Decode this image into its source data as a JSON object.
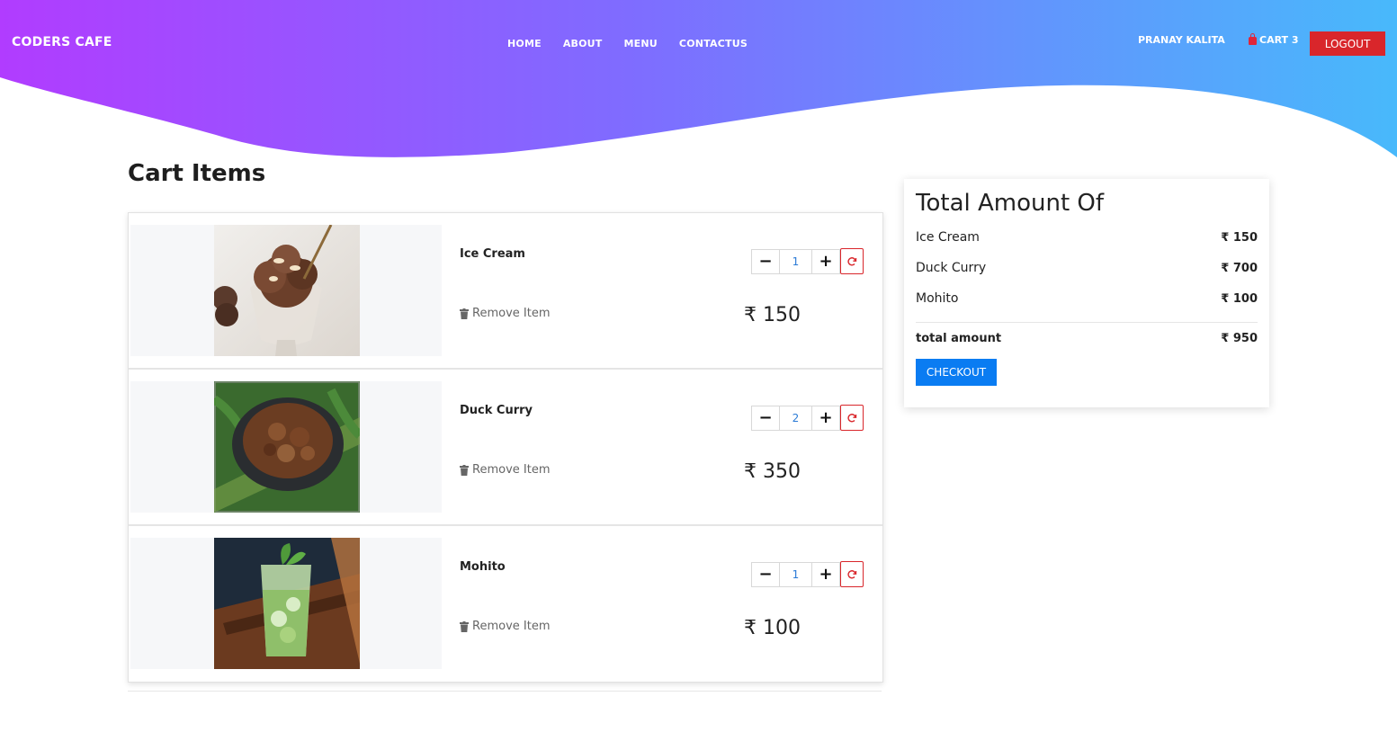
{
  "header": {
    "brand": "CODERS CAFE",
    "nav": [
      "HOME",
      "ABOUT",
      "MENU",
      "CONTACTUS"
    ],
    "user_name": "PRANAY KALITA",
    "cart_label": "CART 3",
    "logout_label": "LOGOUT",
    "gradient_colors": [
      "#b13cff",
      "#8a63ff",
      "#4fb6fb"
    ]
  },
  "main": {
    "title": "Cart Items",
    "items": [
      {
        "name": "Ice Cream",
        "qty": "1",
        "price": "₹ 150",
        "remove_label": "Remove Item",
        "image": "ice-cream-image"
      },
      {
        "name": "Duck Curry",
        "qty": "2",
        "price": "₹ 350",
        "remove_label": "Remove Item",
        "image": "duck-curry-image"
      },
      {
        "name": "Mohito",
        "qty": "1",
        "price": "₹ 100",
        "remove_label": "Remove Item",
        "image": "mohito-image"
      }
    ]
  },
  "summary": {
    "title": "Total Amount Of",
    "lines": [
      {
        "name": "Ice Cream",
        "amount": "₹ 150"
      },
      {
        "name": "Duck Curry",
        "amount": "₹ 700"
      },
      {
        "name": "Mohito",
        "amount": "₹ 100"
      }
    ],
    "total_label": "total amount",
    "total_value": "₹ 950",
    "checkout_label": "CHECKOUT"
  },
  "colors": {
    "logout": "#d9262b",
    "checkout": "#0a7cf2",
    "qty_text": "#2b7bd6"
  }
}
